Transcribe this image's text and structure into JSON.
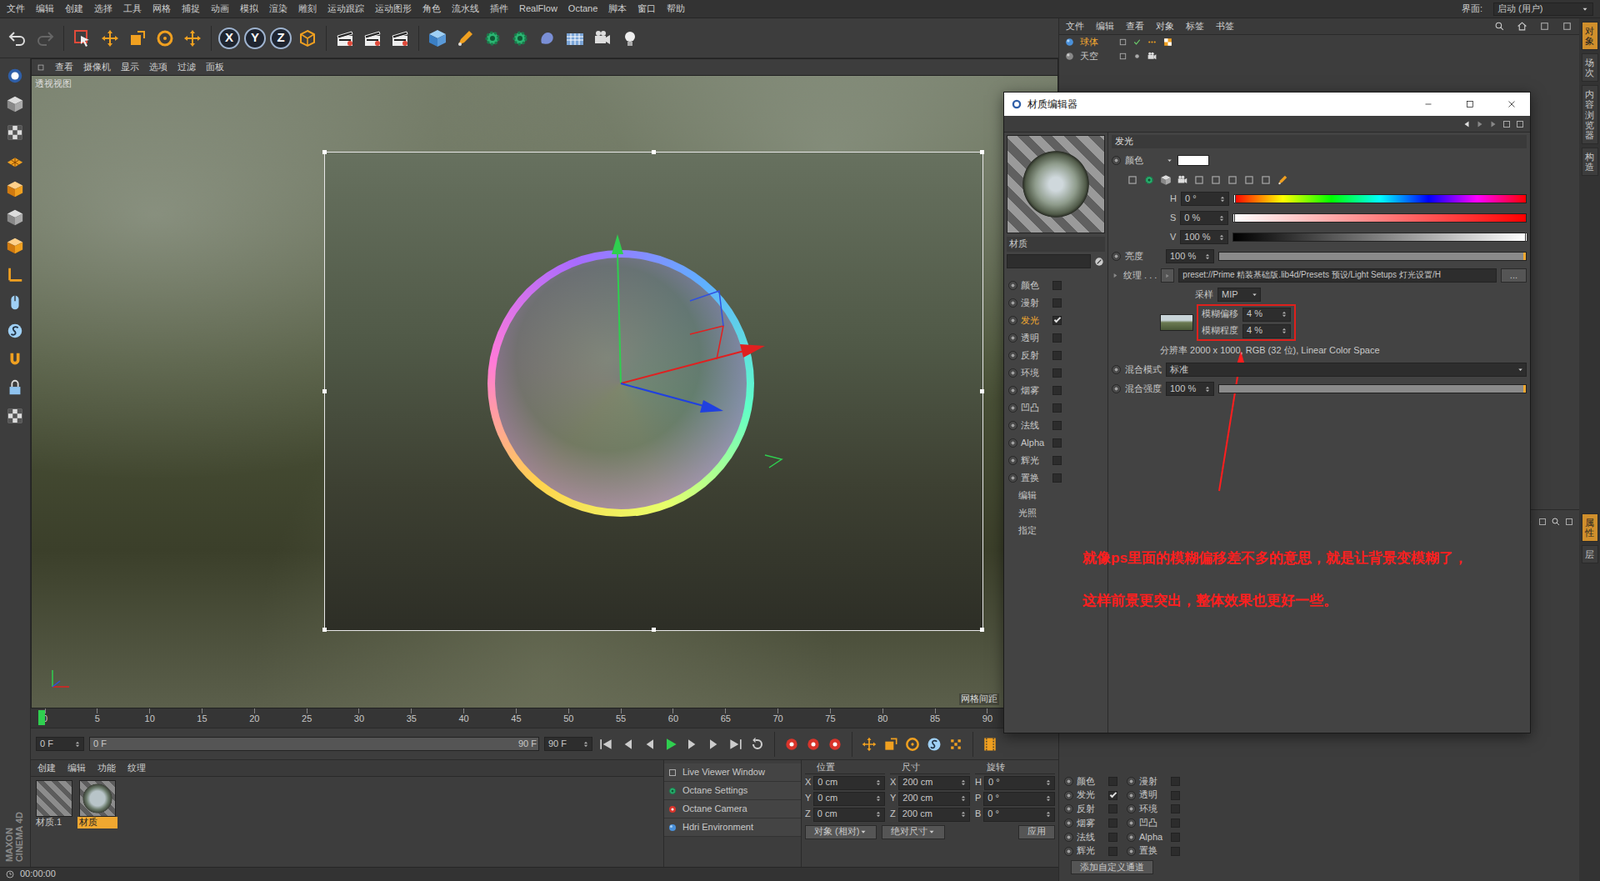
{
  "menu_bar": {
    "items": [
      "文件",
      "编辑",
      "创建",
      "选择",
      "工具",
      "网格",
      "捕捉",
      "动画",
      "模拟",
      "渲染",
      "雕刻",
      "运动跟踪",
      "运动图形",
      "角色",
      "流水线",
      "插件",
      "RealFlow",
      "Octane",
      "脚本",
      "窗口",
      "帮助"
    ],
    "layout_label": "界面:",
    "layout_value": "启动 (用户)"
  },
  "toolbar": {
    "axes": [
      {
        "label": "X",
        "on": true
      },
      {
        "label": "Y",
        "on": true
      },
      {
        "label": "Z",
        "on": true
      }
    ]
  },
  "viewport": {
    "menu": [
      "查看",
      "摄像机",
      "显示",
      "选项",
      "过滤",
      "面板"
    ],
    "title": "透视视图",
    "grid_label": "网格间距"
  },
  "object_manager": {
    "menu": [
      "文件",
      "编辑",
      "查看",
      "对象",
      "标签",
      "书签"
    ],
    "objects": [
      {
        "name": "球体",
        "selected": true
      },
      {
        "name": "天空",
        "selected": false
      }
    ]
  },
  "material_editor": {
    "title": "材质编辑器",
    "material_name_label": "材质",
    "channels": [
      {
        "label": "颜色",
        "checked": false,
        "selected": false
      },
      {
        "label": "漫射",
        "checked": false,
        "selected": false
      },
      {
        "label": "发光",
        "checked": true,
        "selected": true
      },
      {
        "label": "透明",
        "checked": false,
        "selected": false
      },
      {
        "label": "反射",
        "checked": false,
        "selected": false
      },
      {
        "label": "环境",
        "checked": false,
        "selected": false
      },
      {
        "label": "烟雾",
        "checked": false,
        "selected": false
      },
      {
        "label": "凹凸",
        "checked": false,
        "selected": false
      },
      {
        "label": "法线",
        "checked": false,
        "selected": false
      },
      {
        "label": "Alpha",
        "checked": false,
        "selected": false
      },
      {
        "label": "辉光",
        "checked": false,
        "selected": false
      },
      {
        "label": "置换",
        "checked": false,
        "selected": false
      }
    ],
    "links": [
      "编辑",
      "光照",
      "指定"
    ],
    "section": "发光",
    "color_label": "颜色",
    "color": "#ffffff",
    "hsv": [
      {
        "label": "H",
        "value": "0 °",
        "level": 0,
        "kind": "hue"
      },
      {
        "label": "S",
        "value": "0 %",
        "level": 0,
        "kind": "sat"
      },
      {
        "label": "V",
        "value": "100 %",
        "level": 1,
        "kind": "val"
      }
    ],
    "brightness": {
      "label": "亮度",
      "value": "100 %",
      "level": 1
    },
    "texture": {
      "label": "纹理 . . .",
      "path": "preset://Prime 精装基础版.lib4d/Presets 预设/Light Setups 灯光设置/H",
      "more": "..."
    },
    "sampling": {
      "label": "采样",
      "value": "MIP"
    },
    "blur": [
      {
        "label": "模糊偏移",
        "value": "4 %"
      },
      {
        "label": "模糊程度",
        "value": "4 %"
      }
    ],
    "resolution": "分辨率 2000 x 1000, RGB (32 位), Linear Color Space",
    "blend_mode": {
      "label": "混合模式",
      "value": "标准"
    },
    "blend_strength": {
      "label": "混合强度",
      "value": "100 %",
      "level": 1
    }
  },
  "annotation": {
    "lines": [
      "就像ps里面的模糊偏移差不多的意思，就是让背景变模糊了，",
      "这样前景更突出，整体效果也更好一些。"
    ]
  },
  "timeline": {
    "ticks": [
      "0",
      "5",
      "10",
      "15",
      "20",
      "25",
      "30",
      "35",
      "40",
      "45",
      "50",
      "55",
      "60",
      "65",
      "70",
      "75",
      "80",
      "85",
      "90"
    ],
    "current_frame": "0 F",
    "range_start": "0 F",
    "range_end": "90 F",
    "end_frame": "90 F",
    "level": 0
  },
  "material_manager": {
    "menu": [
      "创建",
      "编辑",
      "功能",
      "纹理"
    ],
    "materials": [
      {
        "name": "材质.1",
        "selected": false,
        "kind": "striped"
      },
      {
        "name": "材质",
        "selected": true,
        "kind": "sphere"
      }
    ]
  },
  "octane_menu": {
    "items": [
      "Live Viewer Window",
      "Octane Settings",
      "Octane Camera",
      "Hdri Environment"
    ]
  },
  "coordinates": {
    "headers": [
      "位置",
      "尺寸",
      "旋转"
    ],
    "rows": [
      [
        {
          "axis": "X",
          "value": "0 cm"
        },
        {
          "axis": "X",
          "value": "200 cm"
        },
        {
          "axis": "H",
          "value": "0 °"
        }
      ],
      [
        {
          "axis": "Y",
          "value": "0 cm"
        },
        {
          "axis": "Y",
          "value": "200 cm"
        },
        {
          "axis": "P",
          "value": "0 °"
        }
      ],
      [
        {
          "axis": "Z",
          "value": "0 cm"
        },
        {
          "axis": "Z",
          "value": "200 cm"
        },
        {
          "axis": "B",
          "value": "0 °"
        }
      ]
    ],
    "mode": "对象 (相对)",
    "size_mode": "绝对尺寸",
    "apply": "应用"
  },
  "attributes": {
    "channels": [
      {
        "label": "颜色",
        "checked": false
      },
      {
        "label": "漫射",
        "checked": false
      },
      {
        "label": "发光",
        "checked": true
      },
      {
        "label": "透明",
        "checked": false
      },
      {
        "label": "反射",
        "checked": false
      },
      {
        "label": "环境",
        "checked": false
      },
      {
        "label": "烟雾",
        "checked": false
      },
      {
        "label": "凹凸",
        "checked": false
      },
      {
        "label": "法线",
        "checked": false
      },
      {
        "label": "Alpha",
        "checked": false
      },
      {
        "label": "辉光",
        "checked": false
      },
      {
        "label": "置换",
        "checked": false
      }
    ],
    "add_button": "添加自定义通道"
  },
  "side_tabs": [
    {
      "label": "对象",
      "selected": true,
      "group": "top"
    },
    {
      "label": "场次",
      "selected": false,
      "group": "top"
    },
    {
      "label": "内容浏览器",
      "selected": false,
      "group": "top"
    },
    {
      "label": "构造",
      "selected": false,
      "group": "top"
    },
    {
      "label": "属性",
      "selected": true,
      "group": "bottom"
    },
    {
      "label": "层",
      "selected": false,
      "group": "bottom"
    }
  ],
  "status_bar": {
    "time": "00:00:00"
  },
  "logo": {
    "lines": [
      "MAXON",
      "CINEMA 4D"
    ]
  }
}
